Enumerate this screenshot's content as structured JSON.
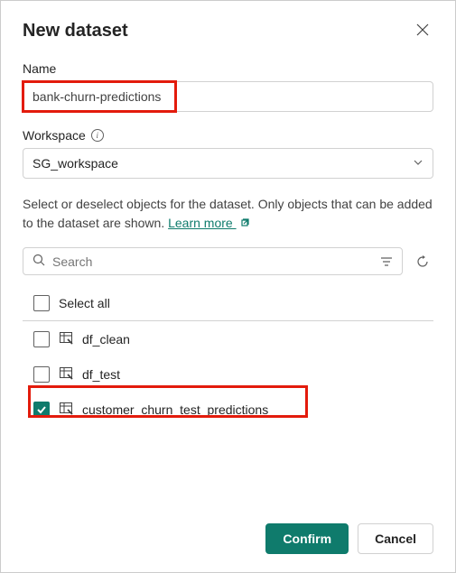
{
  "dialog": {
    "title": "New dataset"
  },
  "name": {
    "label": "Name",
    "value": "bank-churn-predictions"
  },
  "workspace": {
    "label": "Workspace",
    "value": "SG_workspace"
  },
  "helper": {
    "text_a": "Select or deselect objects for the dataset. Only objects that can be added to the dataset are shown. ",
    "link": "Learn more "
  },
  "search": {
    "placeholder": "Search"
  },
  "list": {
    "select_all": "Select all",
    "items": [
      {
        "label": "df_clean",
        "checked": false
      },
      {
        "label": "df_test",
        "checked": false
      },
      {
        "label": "customer_churn_test_predictions",
        "checked": true
      }
    ]
  },
  "footer": {
    "confirm": "Confirm",
    "cancel": "Cancel"
  }
}
